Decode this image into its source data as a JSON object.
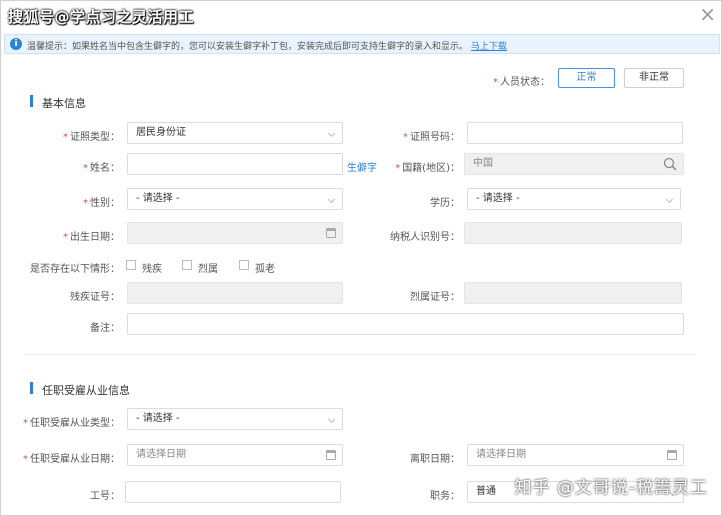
{
  "watermark_top": "搜狐号@学点习之灵活用工",
  "watermark_bottom": "知乎 @文哥说-税籌灵工",
  "notice": {
    "text": "温馨提示：如果姓名当中包含生僻字的，您可以安装生僻字补丁包，安装完成后即可支持生僻字的录入和显示。",
    "link": "马上下载"
  },
  "status": {
    "label": "人员状态：",
    "options": [
      "正常",
      "非正常"
    ],
    "selected": "正常"
  },
  "basic": {
    "title": "基本信息",
    "id_type_label": "证照类型：",
    "id_type_value": "居民身份证",
    "id_number_label": "证照号码：",
    "id_number_value": "",
    "name_label": "姓名：",
    "name_value": "",
    "rare_char_link": "生僻字",
    "nationality_label": "国籍(地区)：",
    "nationality_value": "中国",
    "gender_label": "性别：",
    "gender_value": "- 请选择 -",
    "education_label": "学历：",
    "education_value": "- 请选择 -",
    "birth_label": "出生日期：",
    "taxpayer_label": "纳税人识别号：",
    "situation_label": "是否存在以下情形：",
    "situations": [
      "残疾",
      "烈属",
      "孤老"
    ],
    "disability_no_label": "残疾证号：",
    "martyr_no_label": "烈属证号：",
    "remark_label": "备注："
  },
  "employment": {
    "title": "任职受雇从业信息",
    "type_label": "任职受雇从业类型：",
    "type_value": "- 请选择 -",
    "date_label": "任职受雇从业日期：",
    "date_placeholder": "请选择日期",
    "leave_label": "离职日期：",
    "leave_placeholder": "请选择日期",
    "job_no_label": "工号：",
    "position_label": "职务：",
    "position_value": "普通"
  },
  "icons": [
    "info-icon",
    "close-icon",
    "chevron-down-icon",
    "calendar-icon",
    "search-icon"
  ]
}
